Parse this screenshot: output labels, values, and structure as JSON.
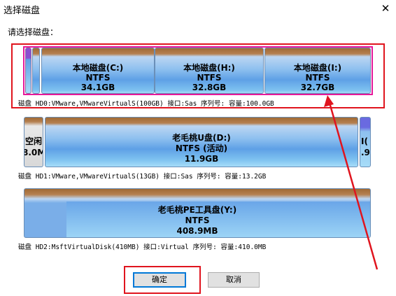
{
  "window": {
    "title": "选择磁盘",
    "close_glyph": "✕"
  },
  "prompt": "请选择磁盘：",
  "disks": [
    {
      "partitions": [
        {
          "name": "本地磁盘(C:)",
          "fs": "NTFS",
          "size": "34.1GB"
        },
        {
          "name": "本地磁盘(H:)",
          "fs": "NTFS",
          "size": "32.8GB"
        },
        {
          "name": "本地磁盘(I:)",
          "fs": "NTFS",
          "size": "32.7GB"
        }
      ],
      "info": "磁盘 HD0:VMware,VMwareVirtualS(100GB)    接口:Sas  序列号:  容量:100.0GB"
    },
    {
      "partitions": [
        {
          "name": "空闲",
          "size_partial": "8.0M"
        },
        {
          "name": "老毛桃U盘(D:)",
          "fs": "NTFS (活动)",
          "size": "11.9GB"
        },
        {
          "name": "I(",
          "size_partial": ".9"
        }
      ],
      "info": "磁盘 HD1:VMware,VMwareVirtualS(13GB)    接口:Sas  序列号:   容量:13.2GB"
    },
    {
      "partitions": [
        {
          "name": "老毛桃PE工具盘(Y:)",
          "fs": "NTFS",
          "size": "408.9MB"
        }
      ],
      "info": "磁盘 HD2:MsftVirtualDisk(410MB)    接口:Virtual  序列号:    容量:410.0MB"
    }
  ],
  "buttons": {
    "ok": "确定",
    "cancel": "取消"
  },
  "colors": {
    "annotation_red": "#e0141e",
    "selection_pink": "#e6189a",
    "partition_blue": "#5ea0e6",
    "partition_header": "#a06a35"
  }
}
